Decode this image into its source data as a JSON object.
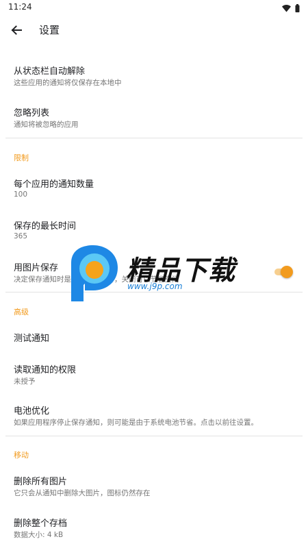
{
  "status_bar": {
    "time": "11:24",
    "icons": [
      "wifi-icon",
      "battery-icon"
    ]
  },
  "app_bar": {
    "back_icon": "arrow-left-icon",
    "title": "设置"
  },
  "prefs": {
    "auto_dismiss": {
      "title": "从状态栏自动解除",
      "summary": "这些应用的通知将仅保存在本地中"
    },
    "ignore_list": {
      "title": "忽略列表",
      "summary": "通知将被忽略的应用"
    },
    "limits_header": "限制",
    "per_app_count": {
      "title": "每个应用的通知数量",
      "summary": "100"
    },
    "max_time": {
      "title": "保存的最长时间",
      "summary": "365"
    },
    "save_images": {
      "title": "用图片保存",
      "summary": "决定保存通知时是否保存大图片，关闭可以节省空间",
      "enabled": true
    },
    "advanced_header": "高级",
    "test_notification": {
      "title": "测试通知"
    },
    "read_permission": {
      "title": "读取通知的权限",
      "summary": "未授予"
    },
    "battery": {
      "title": "电池优化",
      "summary": "如果应用程序停止保存通知，则可能是由于系统电池节省。点击以前往设置。"
    },
    "move_header": "移动",
    "delete_images": {
      "title": "删除所有图片",
      "summary": "它只会从通知中删除大图片，图标仍然存在"
    },
    "delete_archive": {
      "title": "删除整个存档",
      "summary": "数据大小: 4 kB"
    }
  },
  "watermark": {
    "text": "精品下载",
    "url": "www.j9p.com"
  },
  "colors": {
    "accent": "#f29b1e",
    "switch_track": "#f7cf8f",
    "divider": "#e2e2e2",
    "summary_text": "#757575",
    "logo_blue": "#1e88e5",
    "logo_orange": "#f6a31b"
  }
}
